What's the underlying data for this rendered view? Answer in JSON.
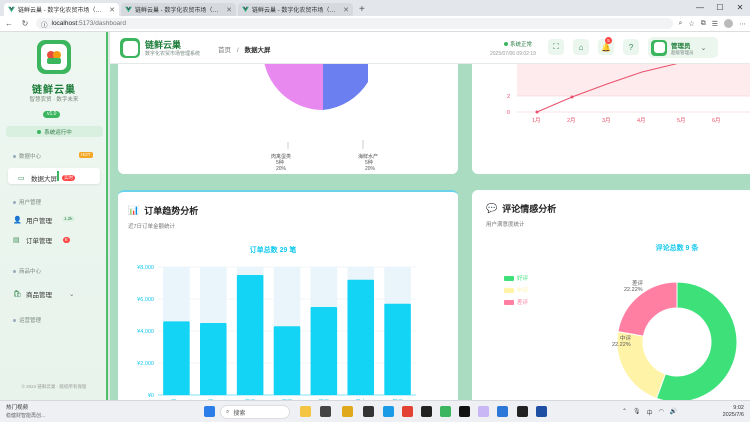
{
  "browser": {
    "tabs": [
      {
        "title": "链鲜云巢 - 数字化农贸市场（用户...",
        "active": true
      },
      {
        "title": "链鲜云巢 - 数字化农贸市场（用...",
        "active": false
      },
      {
        "title": "链鲜云巢 - 数字化农贸市场（管理...",
        "active": false
      }
    ],
    "new_tab": "+",
    "url_host": "localhost",
    "url_path": ":5173/dashboard",
    "controls": {
      "minimize": "—",
      "maximize": "☐",
      "close": "✕"
    }
  },
  "sidebar": {
    "brand": "链鲜云巢",
    "brand_sub": "智慧农贸 · 数字未来",
    "version": "v1.0",
    "status": "系统运行中",
    "sections": [
      {
        "title": "数据中心",
        "badge": "HOT"
      },
      {
        "title": "用户管理"
      },
      {
        "title": "商品中心"
      },
      {
        "title": "运营管理"
      }
    ],
    "items": [
      {
        "label": "数据大屏",
        "badge": "实时",
        "active": true
      },
      {
        "label": "用户管理",
        "badge": "1.2k"
      },
      {
        "label": "订单管理",
        "badge": "8"
      },
      {
        "label": "商品管理",
        "chevron": "⌄"
      }
    ],
    "copyright": "© 2024 链鲜云巢 · 版权所有保留"
  },
  "topbar": {
    "title": "链鲜云巢",
    "subtitle": "数字化农贸市场管理系统",
    "breadcrumb_home": "首页",
    "breadcrumb_sep": "/",
    "breadcrumb_current": "数据大屏",
    "system_status": "系统正常",
    "datetime": "2025/07/06 09:02:19",
    "notification_count": "5",
    "user_name": "管理员",
    "user_role": "超级管理员"
  },
  "top_left_card": {
    "labels": [
      {
        "name": "肉禽蛋类",
        "value": "5种",
        "pct": "20%"
      },
      {
        "name": "海鲜水产",
        "value": "5种",
        "pct": "20%"
      }
    ]
  },
  "top_right_card": {
    "x_ticks": [
      "1月",
      "2月",
      "3月",
      "4月",
      "5月",
      "6月"
    ],
    "y_ticks": [
      "2",
      "0"
    ]
  },
  "order_card": {
    "icon": "📊",
    "title": "订单趋势分析",
    "subtitle": "近7日订单金额统计",
    "total_label": "订单总数 29 笔",
    "chart_data": {
      "type": "bar",
      "categories": [
        "周一",
        "周二",
        "周三",
        "周四",
        "周五",
        "周六",
        "周日"
      ],
      "values": [
        4600,
        4500,
        7500,
        4300,
        5500,
        7200,
        5700
      ],
      "y_ticks": [
        "¥0",
        "¥2,000",
        "¥4,000",
        "¥6,000",
        "¥8,000"
      ],
      "ylim": [
        0,
        8000
      ],
      "bar_color": "#13d4f5",
      "bg_color": "#eaf4fb"
    }
  },
  "review_card": {
    "icon": "💬",
    "title": "评论情感分析",
    "subtitle": "用户满意度统计",
    "total_label": "评论总数 9 条",
    "chart_data": {
      "type": "pie",
      "categories": [
        "好评",
        "中评",
        "差评"
      ],
      "values": [
        55.56,
        22.22,
        22.22
      ],
      "colors": [
        "#3ee07a",
        "#fff3a8",
        "#ff7fa3"
      ],
      "outer_labels": [
        {
          "name": "差评",
          "pct": "22.22%"
        },
        {
          "name": "中评",
          "pct": "22.22%"
        }
      ]
    }
  },
  "taskbar": {
    "weather_title": "热门视频",
    "weather_sub": "稳健财智能再创...",
    "search": "搜索",
    "lang": "中",
    "time": "9:02",
    "date": "2025/7/6"
  }
}
